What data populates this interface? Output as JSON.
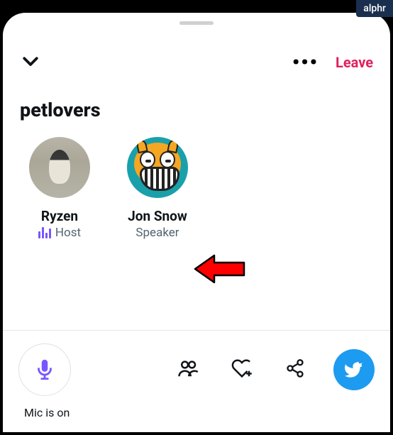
{
  "badge": "alphr",
  "header": {
    "leave_label": "Leave"
  },
  "space": {
    "title": "petlovers"
  },
  "participants": [
    {
      "name": "Ryzen",
      "role": "Host",
      "is_host": true
    },
    {
      "name": "Jon Snow",
      "role": "Speaker",
      "is_host": false
    }
  ],
  "footer": {
    "mic_status": "Mic is on"
  },
  "icons": {
    "chevron": "chevron-down-icon",
    "more": "more-icon",
    "mic": "microphone-icon",
    "people": "people-icon",
    "heart": "heart-plus-icon",
    "share": "share-icon",
    "compose": "compose-icon"
  }
}
